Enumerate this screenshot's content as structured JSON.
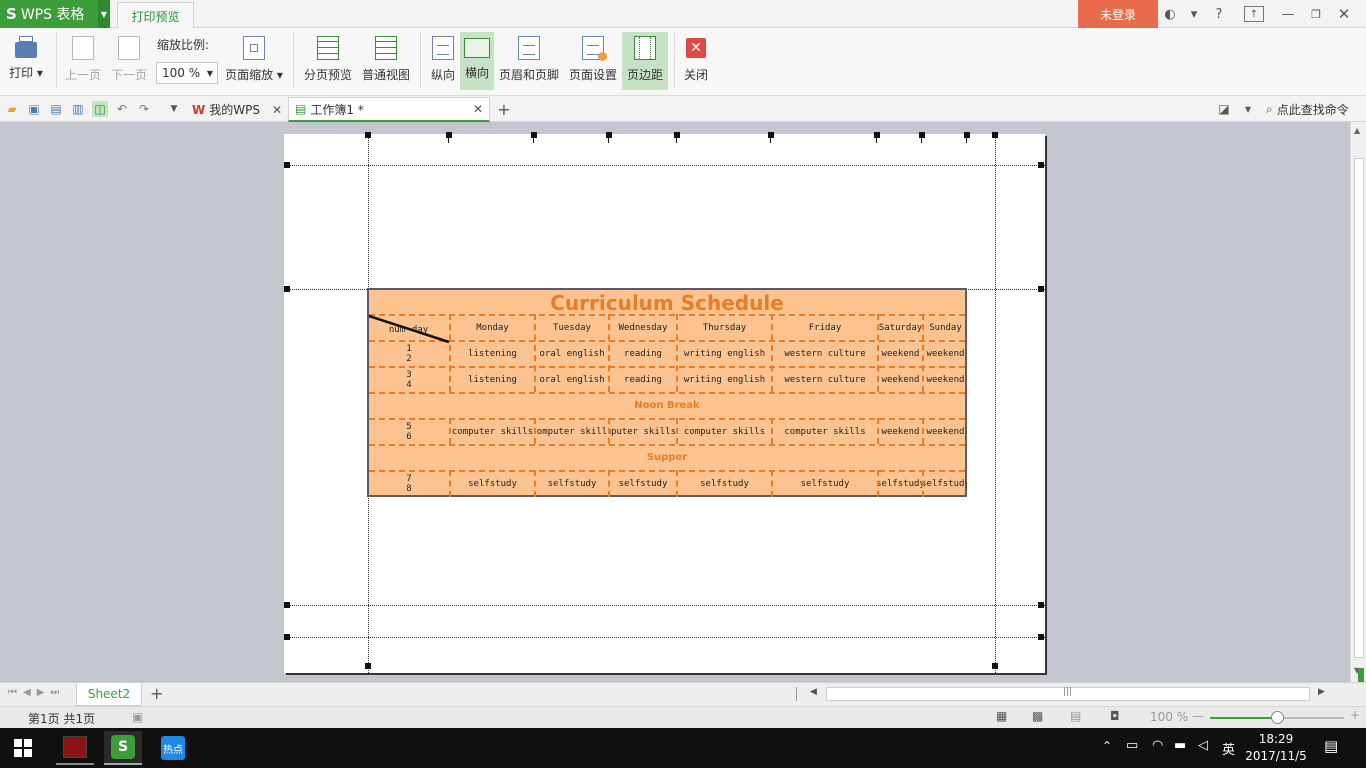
{
  "titlebar": {
    "app_logo": "S",
    "app_name": "WPS 表格",
    "tab_print_preview": "打印预览",
    "login": "未登录",
    "help": "?"
  },
  "ribbon": {
    "print": "打印",
    "prev_page": "上一页",
    "next_page": "下一页",
    "zoom_label": "缩放比例:",
    "zoom_value": "100 %",
    "page_scale": "页面缩放",
    "page_break_preview": "分页预览",
    "normal_view": "普通视图",
    "portrait": "纵向",
    "landscape": "横向",
    "header_footer": "页眉和页脚",
    "page_setup": "页面设置",
    "margins": "页边距",
    "close": "关闭"
  },
  "tabs": {
    "my_wps": "我的WPS",
    "workbook": "工作簿1 *",
    "search": "点此查找命令"
  },
  "sheet": {
    "title": "Curriculum Schedule",
    "corner_num": "num",
    "corner_day": "day",
    "days": [
      "Monday",
      "Tuesday",
      "Wednesday",
      "Thursday",
      "Friday",
      "Saturday",
      "Sunday"
    ],
    "rows": [
      {
        "nums": [
          "1",
          "2"
        ],
        "cells": [
          "listening",
          "oral english",
          "reading",
          "writing english",
          "western culture",
          "weekend",
          "weekend"
        ]
      },
      {
        "nums": [
          "3",
          "4"
        ],
        "cells": [
          "listening",
          "oral english",
          "reading",
          "writing english",
          "western culture",
          "weekend",
          "weekend"
        ]
      },
      {
        "nums": [
          "5",
          "6"
        ],
        "cells": [
          "computer skills",
          "computer skills",
          "computer skills",
          "computer skills",
          "computer skills",
          "weekend",
          "weekend"
        ]
      },
      {
        "nums": [
          "7",
          "8"
        ],
        "cells": [
          "selfstudy",
          "selfstudy",
          "selfstudy",
          "selfstudy",
          "selfstudy",
          "selfstudy",
          "selfstudy"
        ]
      }
    ],
    "noon_break": "Noon Break",
    "supper": "Supper"
  },
  "sheetbar": {
    "sheet_tab": "Sheet2",
    "add": "+"
  },
  "status": {
    "page_info": "第1页 共1页",
    "zoom": "100 %",
    "minus": "—",
    "plus": "+"
  },
  "taskbar": {
    "ime": "英",
    "time": "18:29",
    "date": "2017/11/5",
    "hotspot_app": "热点"
  },
  "colors": {
    "accent_green": "#3c9d3a",
    "login_orange": "#e86b4d",
    "sheet_fill": "#fdc492",
    "sheet_orange": "#e97d25"
  }
}
